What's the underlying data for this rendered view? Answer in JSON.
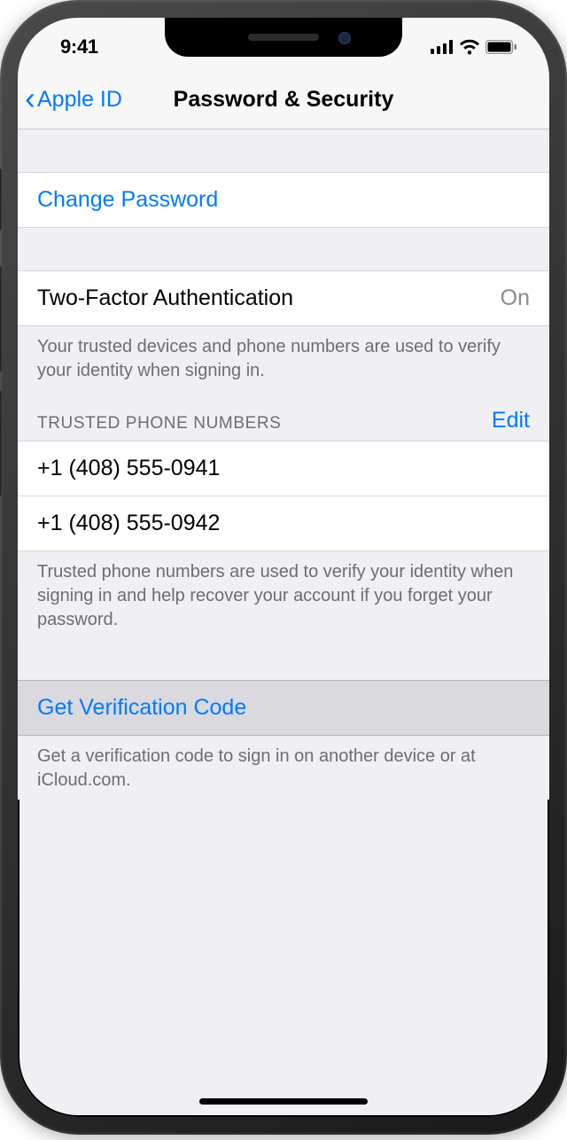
{
  "status": {
    "time": "9:41"
  },
  "nav": {
    "back_label": "Apple ID",
    "title": "Password & Security"
  },
  "change_password": {
    "label": "Change Password"
  },
  "two_factor": {
    "label": "Two-Factor Authentication",
    "value": "On",
    "footer": "Your trusted devices and phone numbers are used to verify your identity when signing in."
  },
  "trusted_numbers": {
    "header": "TRUSTED PHONE NUMBERS",
    "edit_label": "Edit",
    "items": [
      "+1 (408) 555-0941",
      "+1 (408) 555-0942"
    ],
    "footer": "Trusted phone numbers are used to verify your identity when signing in and help recover your account if you forget your password."
  },
  "verification": {
    "label": "Get Verification Code",
    "footer": "Get a verification code to sign in on another device or at iCloud.com."
  }
}
